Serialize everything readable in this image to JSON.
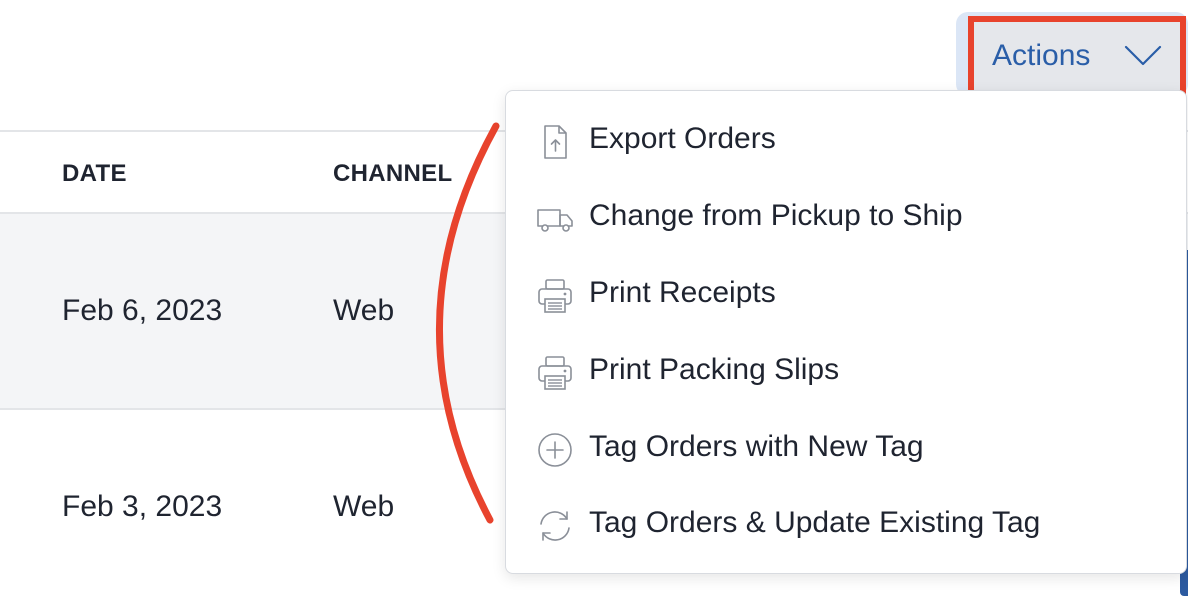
{
  "colors": {
    "accent": "#2a5ea8",
    "highlight_box": "#e8432d",
    "annotation_arc": "#e8432d",
    "row_stripe": "#f4f5f7",
    "icon_gray": "#8a8f98"
  },
  "toolbar": {
    "actions_label": "Actions",
    "actions_icon": "chevron-down-icon"
  },
  "table": {
    "columns": [
      "DATE",
      "CHANNEL"
    ],
    "rows": [
      {
        "date": "Feb 6, 2023",
        "channel": "Web"
      },
      {
        "date": "Feb 3, 2023",
        "channel": "Web"
      }
    ]
  },
  "menu": {
    "items": [
      {
        "label": "Export Orders",
        "icon": "export-file-icon"
      },
      {
        "label": "Change from Pickup to Ship",
        "icon": "truck-icon"
      },
      {
        "label": "Print Receipts",
        "icon": "printer-icon"
      },
      {
        "label": "Print Packing Slips",
        "icon": "printer-icon"
      },
      {
        "label": "Tag Orders with New Tag",
        "icon": "plus-circle-icon"
      },
      {
        "label": "Tag Orders & Update Existing Tag",
        "icon": "refresh-icon"
      }
    ]
  }
}
